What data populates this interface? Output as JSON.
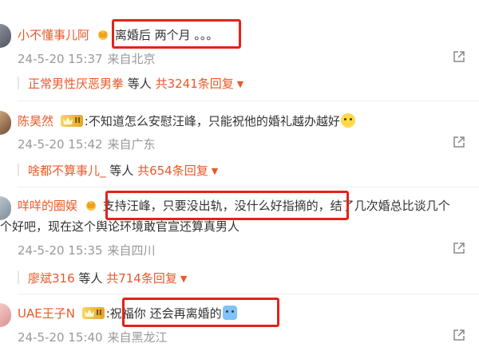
{
  "comments": [
    {
      "username": "小不懂事儿阿",
      "separator": ":",
      "text": "离婚后 两个月 。。。",
      "time": "24-5-20 15:37",
      "location": "来自北京",
      "reply_user": "正常男性厌恶男拳",
      "reply_mid": " 等人 ",
      "reply_count": "共3241条回复",
      "badge": "crown-icon"
    },
    {
      "username": "陈昊然",
      "separator": ":",
      "text": "不知道怎么安慰汪峰，只能祝他的婚礼越办越好",
      "time": "24-5-20 15:42",
      "location": "来自广东",
      "reply_user": "啥都不算事儿_",
      "reply_mid": " 等人 ",
      "reply_count": "共654条回复",
      "badge": "vip-badge",
      "vip_text": "II"
    },
    {
      "username": "咩咩的圈娱",
      "separator": " ",
      "text_highlight": "支持汪峰，只要没出轨，没什么好指摘的，",
      "text_rest": "结了几次婚总比谈几个",
      "text_line2": "个好吧，现在这个舆论环境敢官宣还算真男人",
      "time": "24-5-20 15:35",
      "location": "来自四川",
      "reply_user": "廖斌316",
      "reply_mid": " 等人 ",
      "reply_count": "共714条回复",
      "badge": "crown-icon"
    },
    {
      "username": "UAE王子N",
      "separator": ":",
      "text": "祝福你 还会再离婚的",
      "time": "24-5-20 15:40",
      "location": "来自黑龙江",
      "badge": "vip-badge",
      "vip_text": "II"
    }
  ],
  "colors": {
    "username": "#e8592a",
    "meta": "#999999",
    "highlight_box": "#e2231a"
  }
}
